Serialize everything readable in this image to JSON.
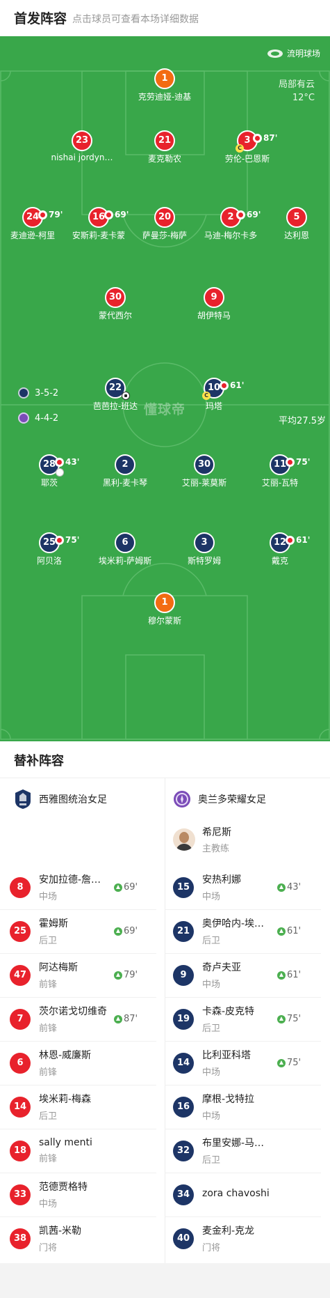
{
  "header": {
    "title": "首发阵容",
    "subtitle": "点击球员可查看本场详细数据"
  },
  "pitch": {
    "venue": "流明球场",
    "weather_line1": "局部有云",
    "weather_line2": "12°C",
    "watermark": "懂球帝",
    "away_formation": "3-5-2",
    "home_formation": "4-4-2",
    "avg_age": "平均27.5岁"
  },
  "colors": {
    "pitch": "#39a74a",
    "red_team": "#e8222c",
    "navy_team": "#1d3566",
    "goalkeeper": "#f36c12",
    "sub_in": "#4caf50"
  },
  "red_players": [
    {
      "num": "1",
      "name": "克劳迪娅-迪基",
      "kind": "orange"
    },
    {
      "num": "23",
      "name": "nishai jordyn…",
      "kind": "red"
    },
    {
      "num": "21",
      "name": "麦克勒农",
      "kind": "red"
    },
    {
      "num": "3",
      "name": "劳伦-巴恩斯",
      "kind": "red",
      "sub": "87'",
      "captain": true
    },
    {
      "num": "24",
      "name": "麦迪逊-柯里",
      "kind": "red",
      "sub": "79'"
    },
    {
      "num": "16",
      "name": "安斯莉-麦卡蒙",
      "kind": "red",
      "sub": "69'"
    },
    {
      "num": "20",
      "name": "萨曼莎-梅萨",
      "kind": "red"
    },
    {
      "num": "2",
      "name": "马迪-梅尔卡多",
      "kind": "red",
      "sub": "69'"
    },
    {
      "num": "5",
      "name": "达利恩",
      "kind": "red"
    },
    {
      "num": "30",
      "name": "蒙代西尔",
      "kind": "red"
    },
    {
      "num": "9",
      "name": "胡伊特马",
      "kind": "red"
    }
  ],
  "navy_players": [
    {
      "num": "22",
      "name": "芭芭拉-班达",
      "kind": "navy",
      "goal": true
    },
    {
      "num": "10",
      "name": "玛塔",
      "kind": "navy",
      "sub": "61'",
      "captain": true
    },
    {
      "num": "28",
      "name": "耶茨",
      "kind": "navy",
      "sub": "43'",
      "card": true
    },
    {
      "num": "2",
      "name": "黑利-麦卡琴",
      "kind": "navy"
    },
    {
      "num": "30",
      "name": "艾丽-莱莫斯",
      "kind": "navy"
    },
    {
      "num": "11",
      "name": "艾丽-瓦特",
      "kind": "navy",
      "sub": "75'"
    },
    {
      "num": "25",
      "name": "阿贝洛",
      "kind": "navy",
      "sub": "75'"
    },
    {
      "num": "6",
      "name": "埃米莉-萨姆斯",
      "kind": "navy"
    },
    {
      "num": "3",
      "name": "斯特罗姆",
      "kind": "navy"
    },
    {
      "num": "12",
      "name": "戴克",
      "kind": "navy",
      "sub": "61'"
    },
    {
      "num": "1",
      "name": "穆尔蒙斯",
      "kind": "orange"
    }
  ],
  "subs": {
    "title": "替补阵容",
    "left_team": "西雅图统治女足",
    "right_team": "奥兰多荣耀女足",
    "coach": {
      "name": "希尼斯",
      "role": "主教练"
    },
    "left": [
      {
        "num": "8",
        "name": "安加拉德-詹…",
        "pos": "中场",
        "in": "69'"
      },
      {
        "num": "25",
        "name": "霍姆斯",
        "pos": "后卫",
        "in": "69'"
      },
      {
        "num": "47",
        "name": "阿达梅斯",
        "pos": "前锋",
        "in": "79'"
      },
      {
        "num": "7",
        "name": "茨尔诺戈切维奇",
        "pos": "前锋",
        "in": "87'"
      },
      {
        "num": "6",
        "name": "林恩-威廉斯",
        "pos": "前锋"
      },
      {
        "num": "14",
        "name": "埃米莉-梅森",
        "pos": "后卫"
      },
      {
        "num": "18",
        "name": "sally menti",
        "pos": "前锋"
      },
      {
        "num": "33",
        "name": "范德贾格特",
        "pos": "中场"
      },
      {
        "num": "38",
        "name": "凯茜-米勒",
        "pos": "门将"
      }
    ],
    "right": [
      {
        "num": "15",
        "name": "安热利娜",
        "pos": "中场",
        "in": "43'"
      },
      {
        "num": "21",
        "name": "奥伊哈内-埃…",
        "pos": "后卫",
        "in": "61'"
      },
      {
        "num": "9",
        "name": "奇卢夫亚",
        "pos": "中场",
        "in": "61'"
      },
      {
        "num": "19",
        "name": "卡森-皮克特",
        "pos": "后卫",
        "in": "75'"
      },
      {
        "num": "14",
        "name": "比利亚科塔",
        "pos": "中场",
        "in": "75'"
      },
      {
        "num": "16",
        "name": "摩根-戈特拉",
        "pos": "中场"
      },
      {
        "num": "32",
        "name": "布里安娜-马…",
        "pos": "后卫"
      },
      {
        "num": "34",
        "name": "zora chavoshi",
        "pos": ""
      },
      {
        "num": "40",
        "name": "麦金利-克龙",
        "pos": "门将"
      }
    ]
  }
}
